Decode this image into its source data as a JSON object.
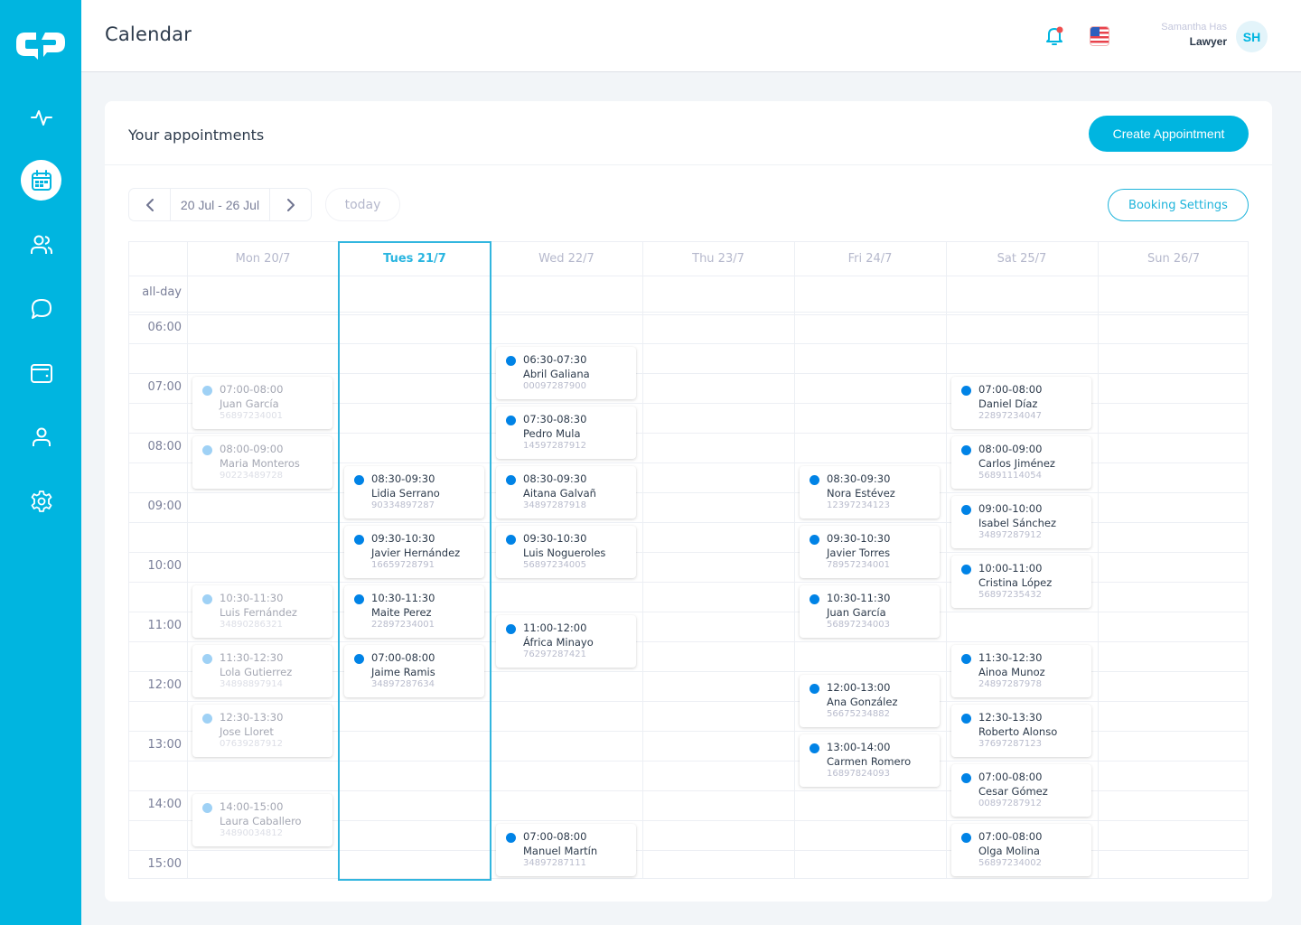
{
  "app": {
    "logo": "cp-logo",
    "page_title": "Calendar"
  },
  "sidebar": {
    "items": [
      {
        "id": "activity",
        "icon": "activity-icon",
        "active": false
      },
      {
        "id": "calendar",
        "icon": "calendar-icon",
        "active": true
      },
      {
        "id": "clients",
        "icon": "users-icon",
        "active": false
      },
      {
        "id": "messages",
        "icon": "chat-icon",
        "active": false
      },
      {
        "id": "wallet",
        "icon": "wallet-icon",
        "active": false
      },
      {
        "id": "profile",
        "icon": "user-icon",
        "active": false
      },
      {
        "id": "settings",
        "icon": "gear-icon",
        "active": false
      }
    ]
  },
  "header": {
    "notification_icon": "bell-icon",
    "has_notification": true,
    "language_flag": "us-flag-icon",
    "user": {
      "name": "Samantha Has",
      "role": "Lawyer",
      "initials": "SH"
    }
  },
  "appointments": {
    "title": "Your appointments",
    "create_label": "Create Appointment",
    "booking_settings_label": "Booking Settings",
    "week_range": "20 Jul - 26 Jul",
    "today_label": "today",
    "all_day_label": "all-day",
    "days": [
      {
        "label": "Mon 20/7",
        "today": false
      },
      {
        "label": "Tues 21/7",
        "today": true
      },
      {
        "label": "Wed 22/7",
        "today": false
      },
      {
        "label": "Thu 23/7",
        "today": false
      },
      {
        "label": "Fri 24/7",
        "today": false
      },
      {
        "label": "Sat 25/7",
        "today": false
      },
      {
        "label": "Sun 26/7",
        "today": false
      }
    ],
    "hours": [
      "06:00",
      "07:00",
      "08:00",
      "09:00",
      "10:00",
      "11:00",
      "12:00",
      "13:00",
      "14:00",
      "15:00"
    ],
    "colors": {
      "accent": "#00b5e0",
      "event_dot": "#0083e6",
      "past_event_dot": "#9fd1f5"
    },
    "events": [
      {
        "day": 0,
        "slot": 2,
        "time": "07:00-08:00",
        "name": "Juan García",
        "phone": "56897234001",
        "past": true
      },
      {
        "day": 0,
        "slot": 4,
        "time": "08:00-09:00",
        "name": "Maria Monteros",
        "phone": "90223489728",
        "past": true
      },
      {
        "day": 0,
        "slot": 9,
        "time": "10:30-11:30",
        "name": "Luis Fernández",
        "phone": "34890286321",
        "past": true
      },
      {
        "day": 0,
        "slot": 11,
        "time": "11:30-12:30",
        "name": "Lola Gutierrez",
        "phone": "34898897914",
        "past": true
      },
      {
        "day": 0,
        "slot": 13,
        "time": "12:30-13:30",
        "name": "Jose Lloret",
        "phone": "07639287912",
        "past": true
      },
      {
        "day": 0,
        "slot": 16,
        "time": "14:00-15:00",
        "name": "Laura Caballero",
        "phone": "34890034812",
        "past": true
      },
      {
        "day": 1,
        "slot": 5,
        "time": "08:30-09:30",
        "name": "Lidia Serrano",
        "phone": "90334897287",
        "past": false
      },
      {
        "day": 1,
        "slot": 7,
        "time": "09:30-10:30",
        "name": "Javier Hernández",
        "phone": "16659728791",
        "past": false
      },
      {
        "day": 1,
        "slot": 9,
        "time": "10:30-11:30",
        "name": "Maite Perez",
        "phone": "22897234001",
        "past": false
      },
      {
        "day": 1,
        "slot": 11,
        "time": "07:00-08:00",
        "name": "Jaime Ramis",
        "phone": "34897287634",
        "past": false
      },
      {
        "day": 2,
        "slot": 1,
        "time": "06:30-07:30",
        "name": "Abril Galiana",
        "phone": "00097287900",
        "past": false
      },
      {
        "day": 2,
        "slot": 3,
        "time": "07:30-08:30",
        "name": "Pedro Mula",
        "phone": "14597287912",
        "past": false
      },
      {
        "day": 2,
        "slot": 5,
        "time": "08:30-09:30",
        "name": "Aitana Galvañ",
        "phone": "34897287918",
        "past": false
      },
      {
        "day": 2,
        "slot": 7,
        "time": "09:30-10:30",
        "name": "Luis Nogueroles",
        "phone": "56897234005",
        "past": false
      },
      {
        "day": 2,
        "slot": 10,
        "time": "11:00-12:00",
        "name": "África Minayo",
        "phone": "76297287421",
        "past": false
      },
      {
        "day": 2,
        "slot": 17,
        "time": "07:00-08:00",
        "name": "Manuel Martín",
        "phone": "34897287111",
        "past": false
      },
      {
        "day": 4,
        "slot": 5,
        "time": "08:30-09:30",
        "name": "Nora Estévez",
        "phone": "12397234123",
        "past": false
      },
      {
        "day": 4,
        "slot": 7,
        "time": "09:30-10:30",
        "name": "Javier Torres",
        "phone": "78957234001",
        "past": false
      },
      {
        "day": 4,
        "slot": 9,
        "time": "10:30-11:30",
        "name": "Juan García",
        "phone": "56897234003",
        "past": false
      },
      {
        "day": 4,
        "slot": 12,
        "time": "12:00-13:00",
        "name": "Ana González",
        "phone": "56675234882",
        "past": false
      },
      {
        "day": 4,
        "slot": 14,
        "time": "13:00-14:00",
        "name": "Carmen Romero",
        "phone": "16897824093",
        "past": false
      },
      {
        "day": 5,
        "slot": 2,
        "time": "07:00-08:00",
        "name": "Daniel Díaz",
        "phone": "22897234047",
        "past": false
      },
      {
        "day": 5,
        "slot": 4,
        "time": "08:00-09:00",
        "name": "Carlos Jiménez",
        "phone": "56891114054",
        "past": false
      },
      {
        "day": 5,
        "slot": 6,
        "time": "09:00-10:00",
        "name": "Isabel Sánchez",
        "phone": "34897287912",
        "past": false
      },
      {
        "day": 5,
        "slot": 8,
        "time": "10:00-11:00",
        "name": "Cristina López",
        "phone": "56897235432",
        "past": false
      },
      {
        "day": 5,
        "slot": 11,
        "time": "11:30-12:30",
        "name": "Ainoa Munoz",
        "phone": "24897287978",
        "past": false
      },
      {
        "day": 5,
        "slot": 13,
        "time": "12:30-13:30",
        "name": "Roberto Alonso",
        "phone": "37697287123",
        "past": false
      },
      {
        "day": 5,
        "slot": 15,
        "time": "07:00-08:00",
        "name": "Cesar Gómez",
        "phone": "00897287912",
        "past": false
      },
      {
        "day": 5,
        "slot": 17,
        "time": "07:00-08:00",
        "name": "Olga Molina",
        "phone": "56897234002",
        "past": false
      }
    ]
  }
}
